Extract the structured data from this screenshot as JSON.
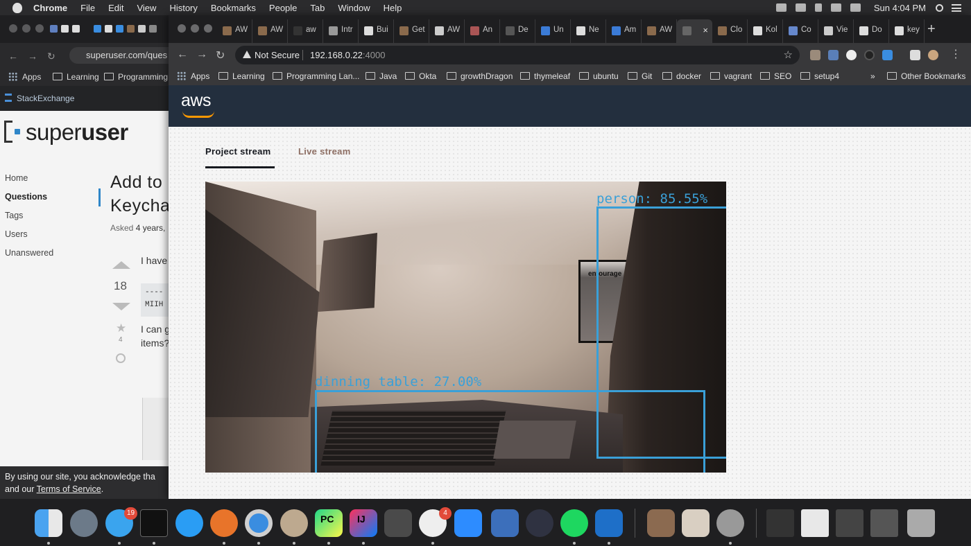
{
  "menubar": {
    "app": "Chrome",
    "items": [
      "File",
      "Edit",
      "View",
      "History",
      "Bookmarks",
      "People",
      "Tab",
      "Window",
      "Help"
    ],
    "clock": "Sun 4:04 PM"
  },
  "bg_window": {
    "url": "superuser.com/ques",
    "bookmarks": [
      "Apps",
      "Learning",
      "Programming L"
    ],
    "stackexchange": "StackExchange",
    "site_name_regular": "super",
    "site_name_bold": "user",
    "nav": [
      "Home",
      "Questions",
      "Tags",
      "Users",
      "Unanswered"
    ],
    "question_title_line1": "Add to",
    "question_title_line2": "Keycha",
    "asked_label": "Asked",
    "asked_value": "4 years,",
    "votes": "18",
    "favorites": "4",
    "body_line1": "I have",
    "code_line1": "----",
    "code_line2": "MIIH",
    "body_line2": "I can g",
    "body_line3": "items?",
    "cookie_line1": "By using our site, you acknowledge tha",
    "cookie_and": "and our",
    "cookie_tos": "Terms of Service",
    "cookie_dot": "."
  },
  "tabs": [
    {
      "title": "AW",
      "color": "#8a6a4c"
    },
    {
      "title": "AW",
      "color": "#8a6a4c"
    },
    {
      "title": "aw",
      "color": "#333333"
    },
    {
      "title": "Intr",
      "color": "#999999"
    },
    {
      "title": "Bui",
      "color": "#dddddd"
    },
    {
      "title": "Get",
      "color": "#8a6a4c"
    },
    {
      "title": "AW",
      "color": "#cccccc"
    },
    {
      "title": "An",
      "color": "#aa5555"
    },
    {
      "title": "De",
      "color": "#555555"
    },
    {
      "title": "Un",
      "color": "#3b7bd6"
    },
    {
      "title": "Ne",
      "color": "#dddddd"
    },
    {
      "title": "Am",
      "color": "#3b7bd6"
    },
    {
      "title": "AW",
      "color": "#8a6a4c"
    },
    {
      "title": "",
      "color": "#666666"
    },
    {
      "title": "Clo",
      "color": "#8a6a4c"
    },
    {
      "title": "Kol",
      "color": "#dddddd"
    },
    {
      "title": "Co",
      "color": "#6688cc"
    },
    {
      "title": "Vie",
      "color": "#cccccc"
    },
    {
      "title": "Do",
      "color": "#dddddd"
    },
    {
      "title": "key",
      "color": "#dddddd"
    }
  ],
  "active_tab_close": "×",
  "new_tab": "+",
  "address": {
    "security": "Not Secure",
    "host": "192.168.0.22",
    "port": ":4000"
  },
  "bookmarks": [
    "Apps",
    "Learning",
    "Programming Lan...",
    "Java",
    "Okta",
    "growthDragon",
    "thymeleaf",
    "ubuntu",
    "Git",
    "docker",
    "vagrant",
    "SEO",
    "setup4"
  ],
  "bookmarks_overflow": "»",
  "other_bookmarks": "Other Bookmarks",
  "aws_logo": "aws",
  "stream_tabs": {
    "project": "Project stream",
    "live": "Live stream",
    "active": "project"
  },
  "camera": {
    "poster_text": "entourage",
    "detections": [
      {
        "label": "person: 85.55%",
        "color": "#3aa0d8"
      },
      {
        "label": "dinning table: 27.00%",
        "color": "#3aa0d8"
      }
    ]
  },
  "dock": {
    "badges": {
      "messages": "19",
      "slack": "4"
    },
    "pycharm": "PC",
    "intellij": "IJ"
  }
}
